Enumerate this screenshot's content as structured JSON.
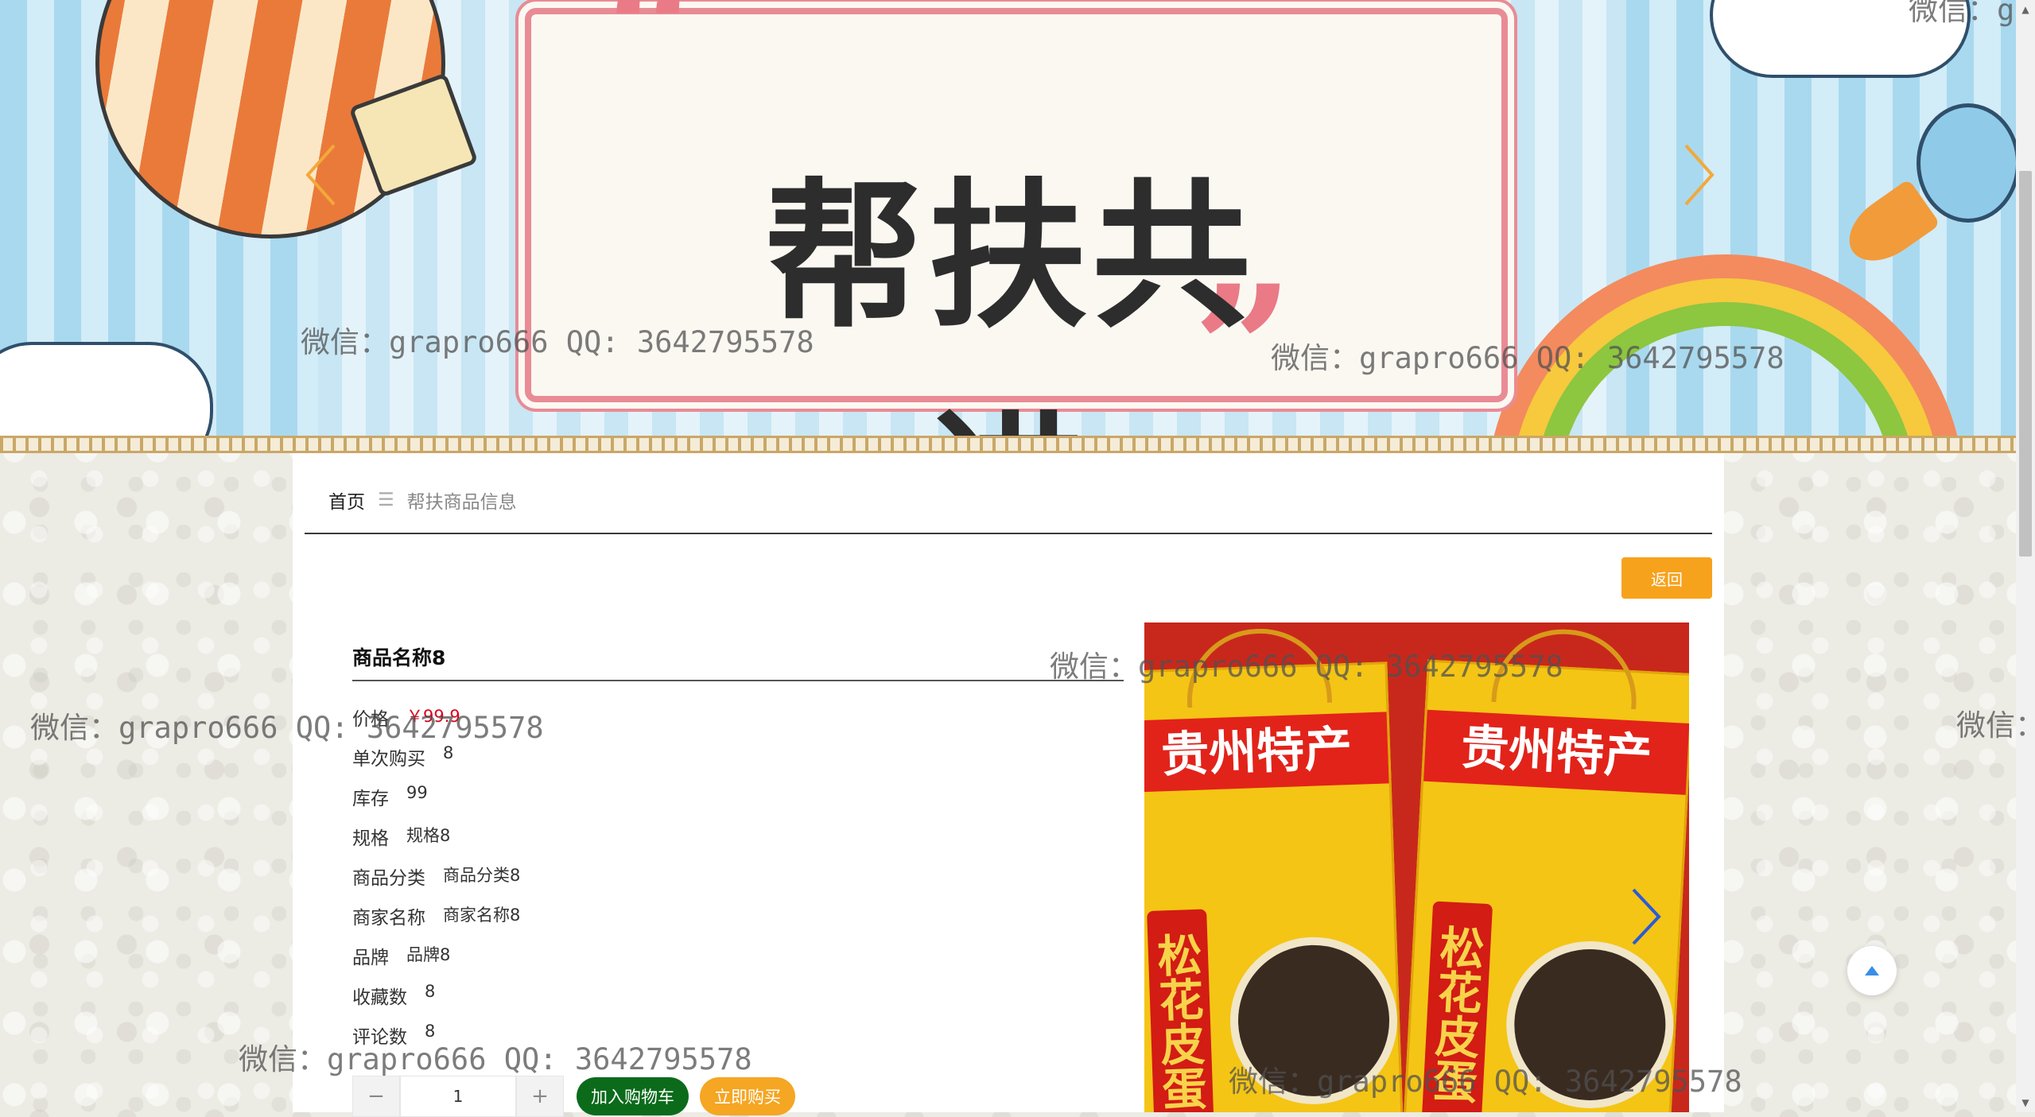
{
  "banner": {
    "title": "帮扶共进",
    "prev_icon": "chevron-left-icon",
    "next_icon": "chevron-right-icon",
    "arrow_color": "#f2a93b"
  },
  "breadcrumb": {
    "home": "首页",
    "separator": "☰",
    "current": "帮扶商品信息"
  },
  "back_button": {
    "label": "返回"
  },
  "product": {
    "name": "商品名称8",
    "attributes": [
      {
        "key": "价格",
        "value": "￥99.9",
        "highlight": true
      },
      {
        "key": "单次购买",
        "value": "8"
      },
      {
        "key": "库存",
        "value": "99"
      },
      {
        "key": "规格",
        "value": "规格8"
      },
      {
        "key": "商品分类",
        "value": "商品分类8"
      },
      {
        "key": "商家名称",
        "value": "商家名称8"
      },
      {
        "key": "品牌",
        "value": "品牌8"
      },
      {
        "key": "收藏数",
        "value": "8"
      },
      {
        "key": "评论数",
        "value": "8"
      }
    ],
    "quantity": "1",
    "minus_label": "−",
    "plus_label": "+",
    "add_to_cart_label": "加入购物车",
    "buy_now_label": "立即购买",
    "image": {
      "box_band_left": "贵州特产",
      "box_band_right": "贵州特产",
      "box_vertical": "松花皮蛋"
    }
  },
  "watermark": {
    "text": "微信：grapro666 QQ: 3642795578",
    "partial_left": "微信：g",
    "partial_right": "微信："
  },
  "colors": {
    "accent_orange": "#f7a21d",
    "cart_green": "#0b6b1b",
    "price_red": "#d9001b",
    "back_to_top": "#3a8ee6"
  }
}
